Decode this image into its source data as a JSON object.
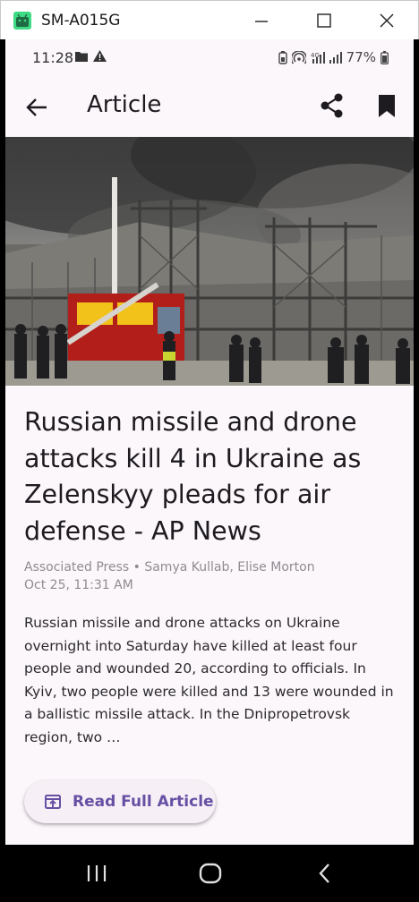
{
  "window": {
    "title": "SM-A015G"
  },
  "status_bar": {
    "time": "11:28",
    "battery": "77%"
  },
  "app_bar": {
    "title": "Article"
  },
  "article": {
    "headline": "Russian missile and drone attacks kill 4 in Ukraine as Zelenskyy pleads for air defense - AP News",
    "byline": "Associated Press • Samya Kullab, Elise Morton",
    "date": "Oct 25, 11:31 AM",
    "summary": "Russian missile and drone attacks on Ukraine overnight into Saturday have killed at least four people and wounded 20, according to officials. In Kyiv, two people were killed and 13 were wounded in a ballistic missile attack. In the Dnipropetrovsk region, two …"
  },
  "actions": {
    "read_full_label": "Read Full Article"
  },
  "icons": {
    "back": "arrow-left-icon",
    "share": "share-icon",
    "bookmark": "bookmark-icon",
    "read": "open-in-app-icon"
  },
  "colors": {
    "accent": "#6750a4",
    "surface": "#fcf7fb",
    "button_bg": "#f6eff6"
  }
}
